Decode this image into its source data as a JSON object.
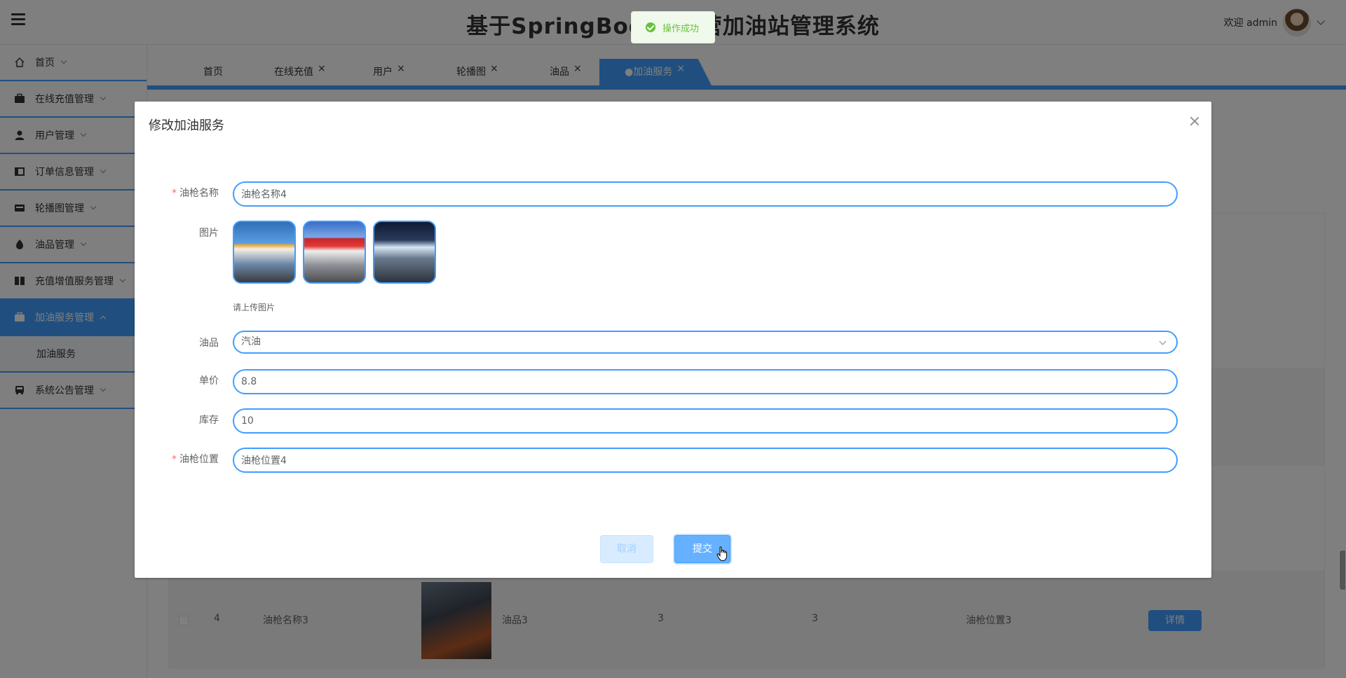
{
  "app": {
    "title": "基于SpringBoot的自营加油站管理系统",
    "welcome": "欢迎 admin"
  },
  "sidebar": {
    "items": [
      {
        "label": "首页"
      },
      {
        "label": "在线充值管理"
      },
      {
        "label": "用户管理"
      },
      {
        "label": "订单信息管理"
      },
      {
        "label": "轮播图管理"
      },
      {
        "label": "油品管理"
      },
      {
        "label": "充值增值服务管理"
      },
      {
        "label": "加油服务管理"
      },
      {
        "label": "系统公告管理"
      }
    ],
    "sub_item": "加油服务"
  },
  "tabs": [
    {
      "label": "首页"
    },
    {
      "label": "在线充值",
      "close": "×"
    },
    {
      "label": "用户",
      "close": "×"
    },
    {
      "label": "轮播图",
      "close": "×"
    },
    {
      "label": "油品",
      "close": "×"
    },
    {
      "label": "●加油服务",
      "close": "×"
    }
  ],
  "table_row": {
    "index": "4",
    "name": "油枪名称3",
    "oil": "油品3",
    "price": "3",
    "stock": "3",
    "position": "油枪位置3",
    "detail_label": "详情"
  },
  "toast": {
    "text": "操作成功"
  },
  "dialog": {
    "title": "修改加油服务",
    "form": {
      "name": {
        "label": "油枪名称",
        "value": "油枪名称4",
        "required_mark": "*"
      },
      "images": {
        "label": "图片",
        "tip": "请上传图片"
      },
      "oil": {
        "label": "油品",
        "value": "汽油"
      },
      "price": {
        "label": "单价",
        "value": "8.8"
      },
      "stock": {
        "label": "库存",
        "value": "10"
      },
      "position": {
        "label": "油枪位置",
        "value": "油枪位置4",
        "required_mark": "*"
      }
    },
    "cancel_label": "取消",
    "submit_label": "提交"
  },
  "colors": {
    "primary": "#409eff",
    "success": "#67c23a",
    "danger": "#f56c6c"
  }
}
